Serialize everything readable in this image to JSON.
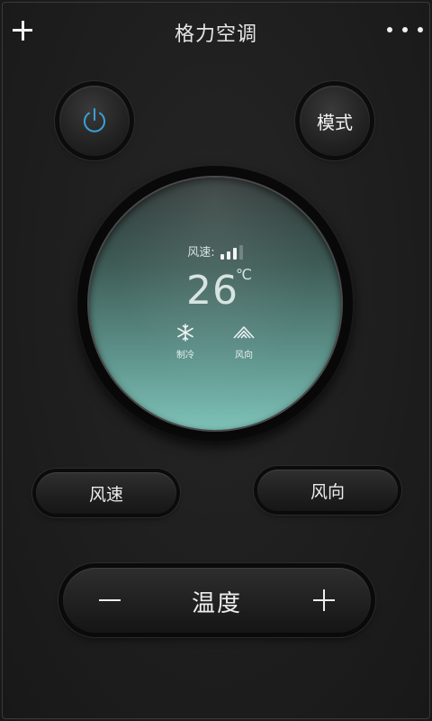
{
  "header": {
    "title": "格力空调",
    "add_icon": "plus-icon",
    "more_icon": "more-dots-icon"
  },
  "controls": {
    "power_icon": "power-icon",
    "mode_label": "模式",
    "fan_speed_label": "风速",
    "fan_direction_label": "风向",
    "temperature_label": "温度",
    "minus_icon": "minus-icon",
    "plus_icon": "plus-icon"
  },
  "display": {
    "fan_speed_label": "风速:",
    "fan_speed_level": 3,
    "fan_speed_max": 4,
    "temperature": "26",
    "unit": "℃",
    "mode_label": "制冷",
    "mode_icon": "snowflake-icon",
    "direction_label": "风向",
    "direction_icon": "swing-icon"
  },
  "colors": {
    "background": "#1e1e1e",
    "accent_power": "#3aa0d8",
    "display_top": "#2c3533",
    "display_bottom": "#7ec2b8"
  }
}
